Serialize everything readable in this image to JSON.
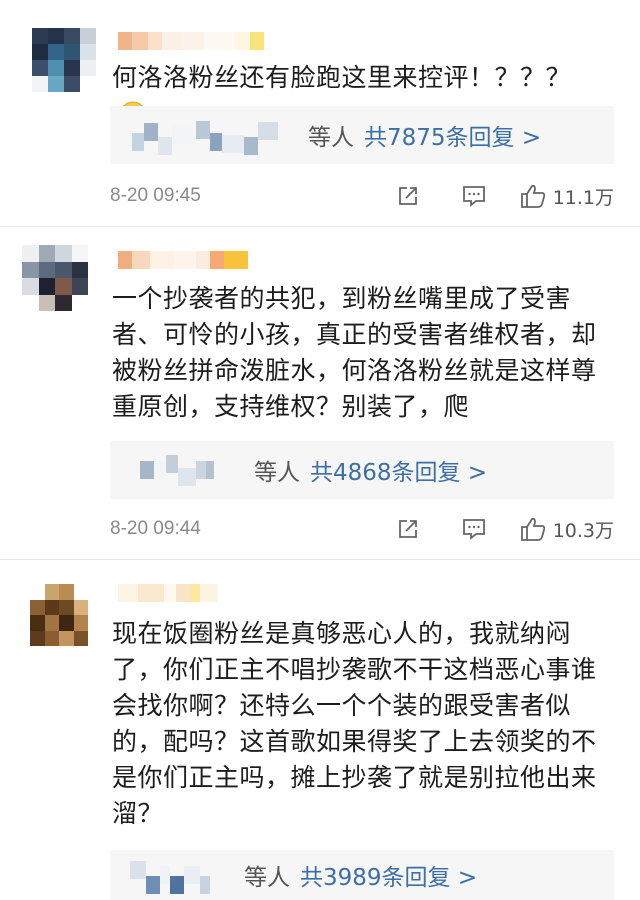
{
  "comments": [
    {
      "text": "何洛洛粉丝还有脸跑这里来控评！？？？",
      "emoji": "grin-sweat-emoji",
      "reply_suffix": "等人",
      "reply_count": "共7875条回复 >",
      "time": "8-20 09:45",
      "likes": "11.1万"
    },
    {
      "text": "一个抄袭者的共犯，到粉丝嘴里成了受害者、可怜的小孩，真正的受害者维权者，却被粉丝拼命泼脏水，何洛洛粉丝就是这样尊重原创，支持维权？别装了，爬",
      "reply_suffix": "等人",
      "reply_count": "共4868条回复 >",
      "time": "8-20 09:44",
      "likes": "10.3万"
    },
    {
      "text": "现在饭圈粉丝是真够恶心人的，我就纳闷了，你们正主不唱抄袭歌不干这档恶心事谁会找你啊？还特么一个个装的跟受害者似的，配吗？这首歌如果得奖了上去领奖的不是你们正主吗，摊上抄袭了就是别拉他出来溜？",
      "reply_suffix": "等人",
      "reply_count": "共3989条回复 >"
    }
  ],
  "colors": {
    "link": "#3d6fa6",
    "time": "#8a8a8a",
    "reply_bg": "#f6f6f6"
  },
  "icons": [
    "share-icon",
    "comment-icon",
    "like-icon"
  ]
}
